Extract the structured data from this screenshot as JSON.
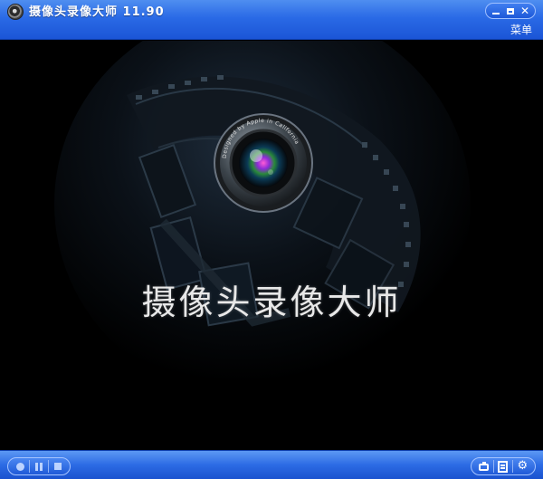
{
  "window": {
    "title": "摄像头录像大师 11.90",
    "menu_label": "菜单",
    "icons": {
      "app": "webcam-icon",
      "minimize": "minimize-icon",
      "maximize": "maximize-icon",
      "close": "close-icon"
    },
    "close_glyph": "✕"
  },
  "splash": {
    "title": "摄像头录像大师",
    "lens_ring_text": "Designed by Apple in California"
  },
  "toolbar": {
    "left_icons": [
      "record-icon",
      "pause-icon",
      "stop-icon"
    ],
    "right_icons": [
      "snapshot-icon",
      "document-icon",
      "gear-icon"
    ],
    "gear_glyph": "⚙"
  },
  "colors": {
    "titlebar_blue": "#2a6ae6",
    "background": "#000000",
    "film_dark": "#0b0d10",
    "film_highlight": "#2a3a4a"
  }
}
